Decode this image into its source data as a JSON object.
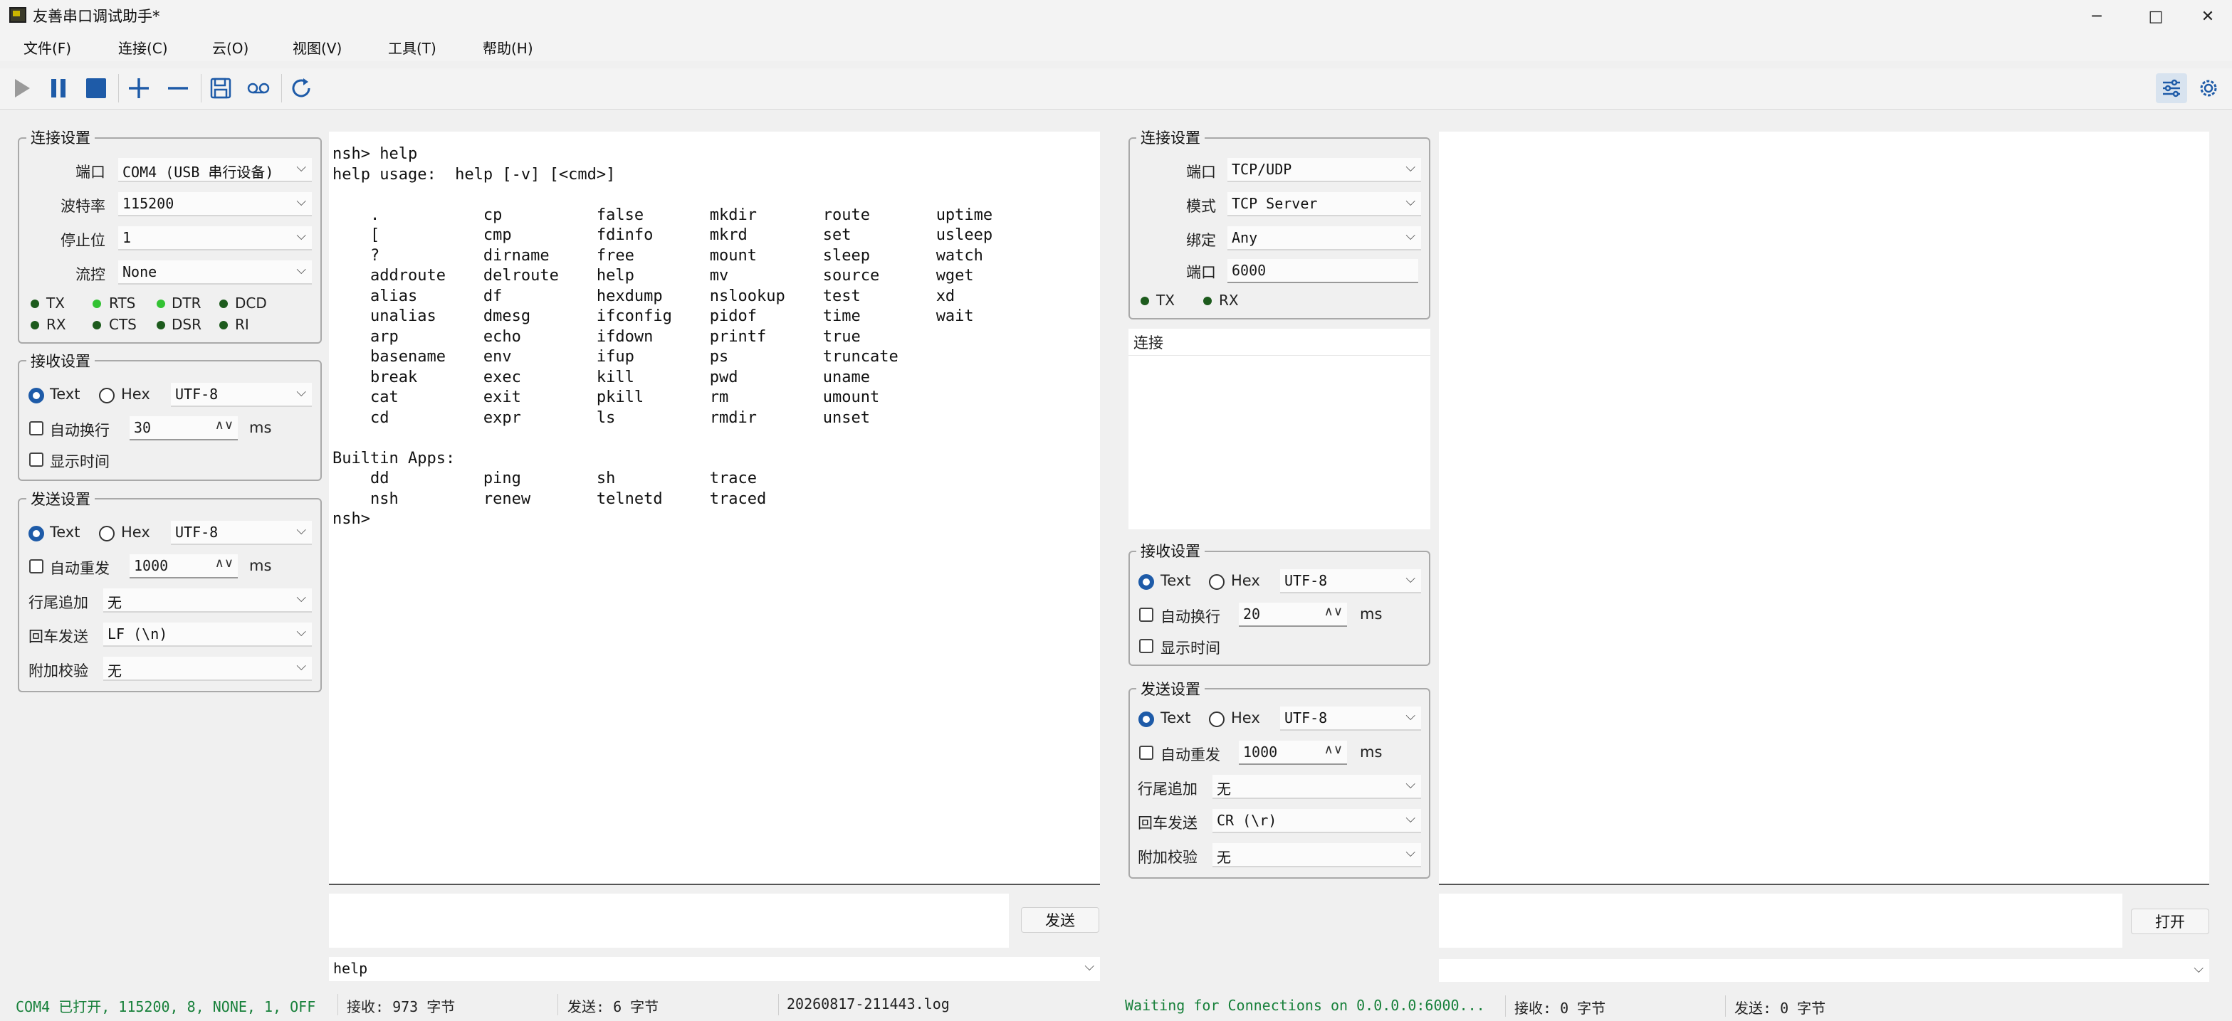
{
  "window": {
    "title": "友善串口调试助手*",
    "controls": [
      "minimize",
      "maximize",
      "close"
    ]
  },
  "menu": [
    "文件(F)",
    "连接(C)",
    "云(O)",
    "视图(V)",
    "工具(T)",
    "帮助(H)"
  ],
  "toolbar": [
    "play-icon",
    "pause-icon",
    "stop-icon",
    "add-icon",
    "remove-icon",
    "save-icon",
    "record-icon",
    "refresh-icon",
    "settings-sliders-icon",
    "gear-icon"
  ],
  "left": {
    "conn": {
      "title": "连接设置",
      "port_label": "端口",
      "port": "COM4 (USB 串行设备)",
      "baud_label": "波特率",
      "baud": "115200",
      "stop_label": "停止位",
      "stop": "1",
      "flow_label": "流控",
      "flow": "None",
      "leds": [
        {
          "name": "TX",
          "on": false
        },
        {
          "name": "RTS",
          "on": true
        },
        {
          "name": "DTR",
          "on": true
        },
        {
          "name": "DCD",
          "on": false
        },
        {
          "name": "RX",
          "on": false
        },
        {
          "name": "CTS",
          "on": false
        },
        {
          "name": "DSR",
          "on": false
        },
        {
          "name": "RI",
          "on": false
        }
      ]
    },
    "recv": {
      "title": "接收设置",
      "text": "Text",
      "hex": "Hex",
      "enc": "UTF-8",
      "wrap": "自动换行",
      "wrap_val": "30",
      "ms": "ms",
      "show_time": "显示时间"
    },
    "send": {
      "title": "发送设置",
      "text": "Text",
      "hex": "Hex",
      "enc": "UTF-8",
      "repeat": "自动重发",
      "repeat_val": "1000",
      "ms": "ms",
      "eol_label": "行尾追加",
      "eol": "无",
      "enter_label": "回车发送",
      "enter": "LF (\\n)",
      "check_label": "附加校验",
      "check": "无"
    }
  },
  "terminal": {
    "text": "nsh> help\nhelp usage:  help [-v] [<cmd>]\n\n    .           cp          false       mkdir       route       uptime\n    [           cmp         fdinfo      mkrd        set         usleep\n    ?           dirname     free        mount       sleep       watch\n    addroute    delroute    help        mv          source      wget\n    alias       df          hexdump     nslookup    test        xd\n    unalias     dmesg       ifconfig    pidof       time        wait\n    arp         echo        ifdown      printf      true\n    basename    env         ifup        ps          truncate\n    break       exec        kill        pwd         uname\n    cat         exit        pkill       rm          umount\n    cd          expr        ls          rmdir       unset\n\nBuiltin Apps:\n    dd          ping        sh          trace\n    nsh         renew       telnetd     traced\nnsh>"
  },
  "send_btn": "发送",
  "history": "help",
  "right": {
    "conn": {
      "title": "连接设置",
      "port_label": "端口",
      "port": "TCP/UDP",
      "mode_label": "模式",
      "mode": "TCP Server",
      "bind_label": "绑定",
      "bind": "Any",
      "portnum_label": "端口",
      "portnum": "6000",
      "tx": "TX",
      "rx": "RX"
    },
    "list_header": "连接",
    "recv": {
      "title": "接收设置",
      "text": "Text",
      "hex": "Hex",
      "enc": "UTF-8",
      "wrap": "自动换行",
      "wrap_val": "20",
      "ms": "ms",
      "show_time": "显示时间"
    },
    "send": {
      "title": "发送设置",
      "text": "Text",
      "hex": "Hex",
      "enc": "UTF-8",
      "repeat": "自动重发",
      "repeat_val": "1000",
      "ms": "ms",
      "eol_label": "行尾追加",
      "eol": "无",
      "enter_label": "回车发送",
      "enter": "CR (\\r)",
      "check_label": "附加校验",
      "check": "无"
    }
  },
  "open_btn": "打开",
  "status": {
    "left_port": "COM4 已打开, 115200, 8, NONE, 1, OFF",
    "left_recv": "接收: 973 字节",
    "left_send": "发送: 6 字节",
    "log": "20260817-211443.log",
    "right_state": "Waiting for Connections on 0.0.0.0:6000...",
    "right_recv": "接收: 0 字节",
    "right_send": "发送: 0 字节"
  },
  "colors": {
    "accent": "#1e5ba8",
    "status_green": "#17803a",
    "led_on": "#33c233",
    "led_off": "#1d5b1d"
  }
}
